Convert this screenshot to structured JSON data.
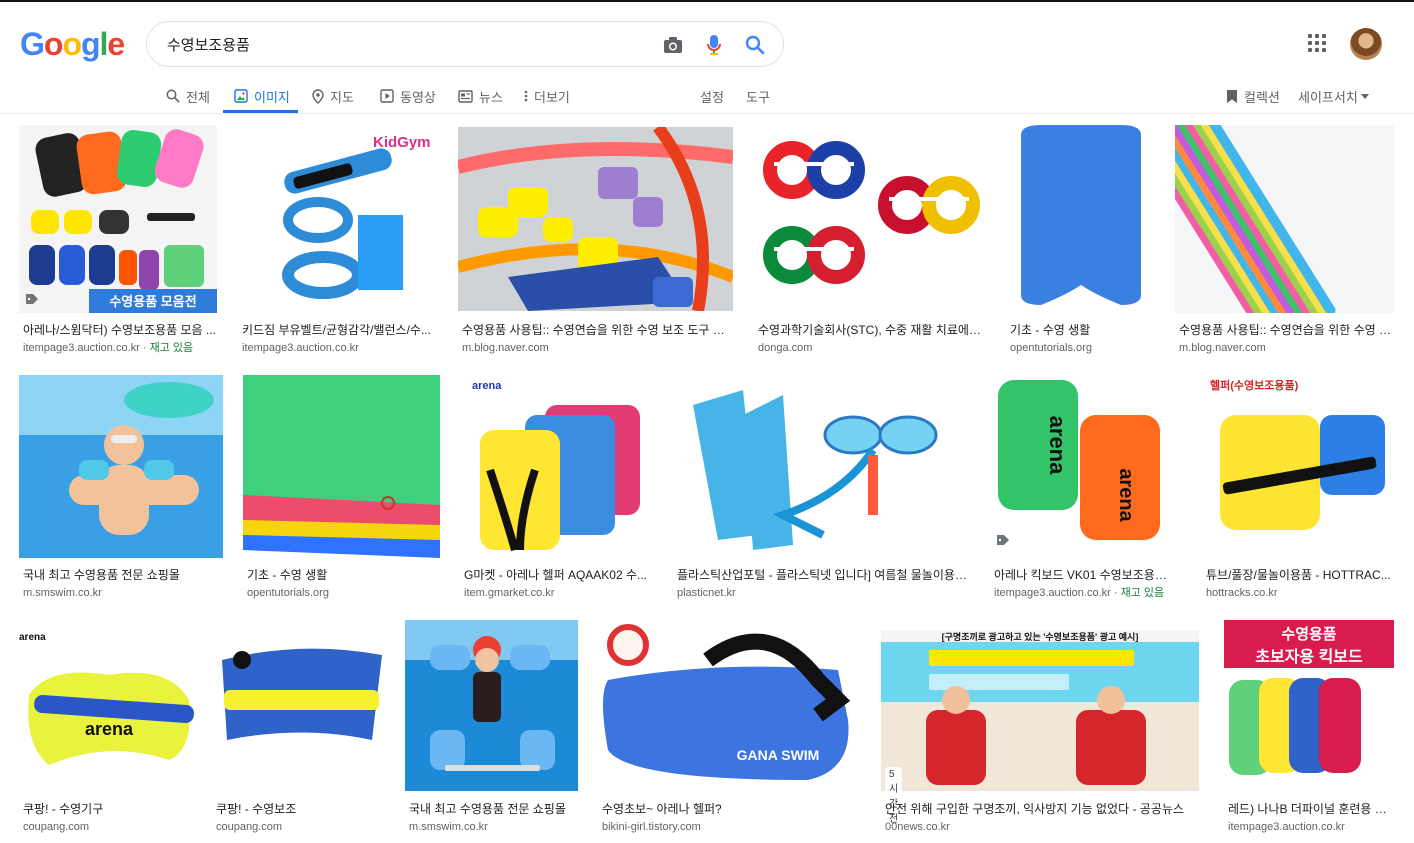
{
  "logo": {
    "letters": [
      "G",
      "o",
      "o",
      "g",
      "l",
      "e"
    ],
    "colors": [
      "#4285F4",
      "#EA4335",
      "#FBBC05",
      "#4285F4",
      "#34A853",
      "#EA4335"
    ]
  },
  "search": {
    "query": "수영보조용품",
    "icons": [
      "camera-icon",
      "mic-icon",
      "search-icon"
    ]
  },
  "colors": {
    "accent": "#1a73e8",
    "stock": "#188038"
  },
  "tabs": [
    {
      "label": "전체",
      "icon": "search-icon"
    },
    {
      "label": "이미지",
      "icon": "image-icon",
      "active": true
    },
    {
      "label": "지도",
      "icon": "pin-icon"
    },
    {
      "label": "동영상",
      "icon": "play-icon"
    },
    {
      "label": "뉴스",
      "icon": "news-icon"
    },
    {
      "label": "더보기",
      "icon": "more-vert-icon"
    }
  ],
  "tools": {
    "settings": "설정",
    "tools": "도구",
    "collections": "컬렉션",
    "safesearch": "세이프서치"
  },
  "results": [
    {
      "caption": "아레나/스윔닥터) 수영보조용품 모음 ...",
      "domain": "itempage3.auction.co.kr",
      "stock": "재고 있음",
      "overlay": "수영용품 모음전"
    },
    {
      "caption": "키드짐 부유벨트/균형감각/밸런스/수...",
      "domain": "itempage3.auction.co.kr",
      "overlay": "KidGym"
    },
    {
      "caption": "수영용품 사용팁:: 수영연습을 위한 수영 보조 도구 사...",
      "domain": "m.blog.naver.com"
    },
    {
      "caption": "수영과학기술회사(STC), 수중 재활 치료에 탁...",
      "domain": "donga.com"
    },
    {
      "caption": "기초 - 수영 생활",
      "domain": "opentutorials.org"
    },
    {
      "caption": "수영용품 사용팁:: 수영연습을 위한 수영 보...",
      "domain": "m.blog.naver.com"
    },
    {
      "caption": "국내 최고 수영용품 전문 쇼핑몰",
      "domain": "m.smswim.co.kr"
    },
    {
      "caption": "기초 - 수영 생활",
      "domain": "opentutorials.org"
    },
    {
      "caption": "G마켓 - 아레나 헬퍼 AQAAK02 수...",
      "domain": "item.gmarket.co.kr",
      "overlay": "arena"
    },
    {
      "caption": "플라스틱산업포털 - 플라스틱넷 입니다] 여름철 물놀이용품...",
      "domain": "plasticnet.kr"
    },
    {
      "caption": "아레나 킥보드 VK01 수영보조용품 ...",
      "domain": "itempage3.auction.co.kr",
      "stock": "재고 있음",
      "overlay": "arena"
    },
    {
      "caption": "튜브/풀장/물놀이용품 - HOTTRAC...",
      "domain": "hottracks.co.kr",
      "overlay": "헬퍼(수영보조용품)"
    },
    {
      "caption": "쿠팡! - 수영기구",
      "domain": "coupang.com",
      "overlay": "arena"
    },
    {
      "caption": "쿠팡! - 수영보조",
      "domain": "coupang.com"
    },
    {
      "caption": "국내 최고 수영용품 전문 쇼핑몰",
      "domain": "m.smswim.co.kr"
    },
    {
      "caption": "수영초보~ 아레나 헬퍼?",
      "domain": "bikini-girl.tistory.com",
      "overlay": "GANA SWIM"
    },
    {
      "caption": "안전 위해 구입한 구명조끼, 익사방지 기능 없었다 - 공공뉴스",
      "domain": "00news.co.kr",
      "badge": "5시간 전",
      "overlay": "[구명조끼로 광고하고 있는 '수영보조용품' 광고 예시]"
    },
    {
      "caption": "레드) 나나B 더파이널 훈련용 킥...",
      "domain": "itempage3.auction.co.kr",
      "overlay": "수영용품 초보자용 킥보드"
    }
  ]
}
